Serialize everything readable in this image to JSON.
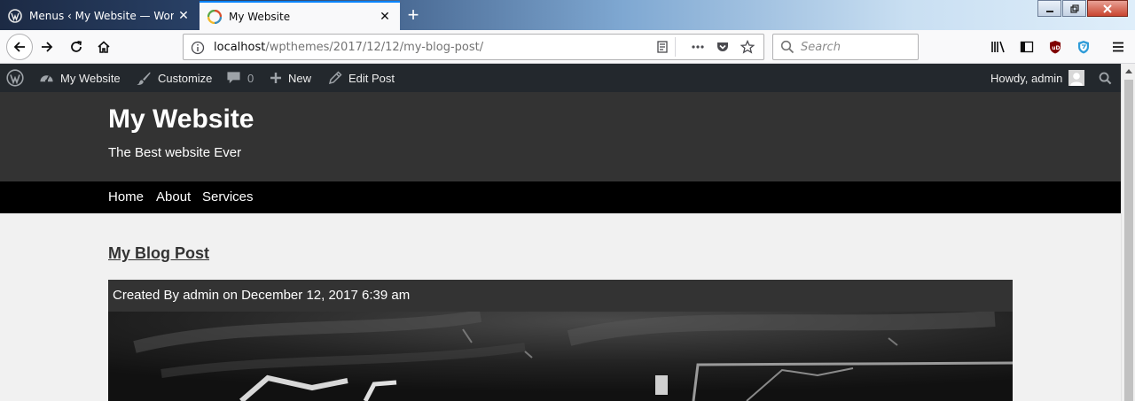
{
  "browser": {
    "tabs": [
      {
        "title": "Menus ‹ My Website — WordPress",
        "favicon": "wordpress-favicon",
        "active": false
      },
      {
        "title": "My Website",
        "favicon": "wordpress-favicon",
        "active": true
      }
    ],
    "address": {
      "host": "localhost",
      "path": "/wpthemes/2017/12/12/my-blog-post/"
    },
    "search_placeholder": "Search",
    "accent_color": "#0a84ff"
  },
  "admin_bar": {
    "site_name": "My Website",
    "customize": "Customize",
    "comments_count": "0",
    "new": "New",
    "edit_post": "Edit Post",
    "howdy": "Howdy, admin"
  },
  "site": {
    "title": "My Website",
    "tagline": "The Best website Ever",
    "nav": [
      "Home",
      "About",
      "Services"
    ]
  },
  "post": {
    "title": "My Blog Post",
    "meta": "Created By admin on December 12, 2017 6:39 am"
  }
}
